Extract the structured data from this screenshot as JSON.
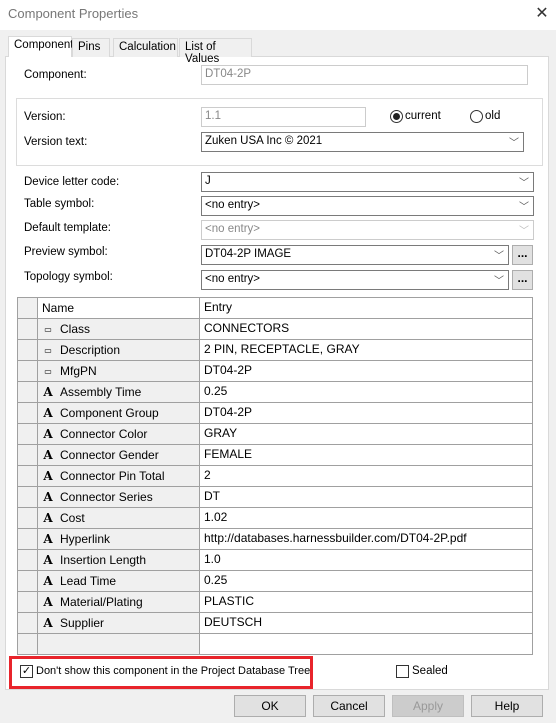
{
  "window": {
    "title": "Component Properties",
    "close_icon": "close-icon"
  },
  "tabs": [
    {
      "label": "Component",
      "active": true
    },
    {
      "label": "Pins"
    },
    {
      "label": "Calculation"
    },
    {
      "label": "List of Values"
    }
  ],
  "form": {
    "component_label": "Component:",
    "component_value": "DT04-2P",
    "version_label": "Version:",
    "version_value": "1.1",
    "radio_current": "current",
    "radio_old": "old",
    "version_selected": "current",
    "version_text_label": "Version text:",
    "version_text_value": "Zuken USA Inc © 2021",
    "device_letter_label": "Device letter code:",
    "device_letter_value": "J",
    "table_symbol_label": "Table symbol:",
    "table_symbol_value": "<no entry>",
    "default_template_label": "Default template:",
    "default_template_value": "<no entry>",
    "preview_symbol_label": "Preview symbol:",
    "preview_symbol_value": "DT04-2P IMAGE",
    "topology_symbol_label": "Topology symbol:",
    "topology_symbol_value": "<no entry>",
    "browse_label": "..."
  },
  "grid": {
    "headers": {
      "name": "Name",
      "entry": "Entry"
    },
    "rows": [
      {
        "icon": "key",
        "name": "Class",
        "entry": "CONNECTORS"
      },
      {
        "icon": "key",
        "name": "Description",
        "entry": "2 PIN, RECEPTACLE, GRAY"
      },
      {
        "icon": "key",
        "name": "MfgPN",
        "entry": "DT04-2P"
      },
      {
        "icon": "A",
        "name": "Assembly Time",
        "entry": "0.25"
      },
      {
        "icon": "A",
        "name": "Component Group",
        "entry": "DT04-2P"
      },
      {
        "icon": "A",
        "name": "Connector Color",
        "entry": "GRAY"
      },
      {
        "icon": "A",
        "name": "Connector Gender",
        "entry": "FEMALE"
      },
      {
        "icon": "A",
        "name": "Connector Pin Total",
        "entry": "2"
      },
      {
        "icon": "A",
        "name": "Connector Series",
        "entry": "DT"
      },
      {
        "icon": "A",
        "name": "Cost",
        "entry": "1.02"
      },
      {
        "icon": "A",
        "name": "Hyperlink",
        "entry": "http://databases.harnessbuilder.com/DT04-2P.pdf"
      },
      {
        "icon": "A",
        "name": "Insertion Length",
        "entry": "1.0"
      },
      {
        "icon": "A",
        "name": "Lead Time",
        "entry": "0.25"
      },
      {
        "icon": "A",
        "name": "Material/Plating",
        "entry": "PLASTIC"
      },
      {
        "icon": "A",
        "name": "Supplier",
        "entry": "DEUTSCH"
      }
    ]
  },
  "options": {
    "dont_show_label": "Don't show this component in the Project Database Tree",
    "dont_show_checked": true,
    "sealed_label": "Sealed",
    "sealed_checked": false,
    "highlight_color": "#e8242b"
  },
  "buttons": {
    "ok": "OK",
    "cancel": "Cancel",
    "apply": "Apply",
    "help": "Help"
  }
}
